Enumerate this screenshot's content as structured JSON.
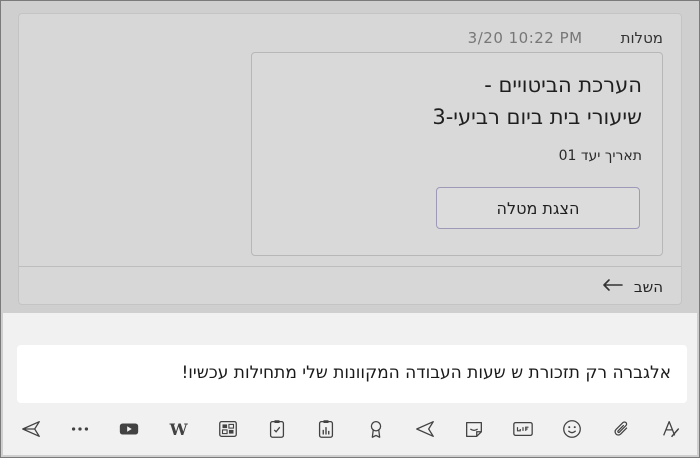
{
  "message": {
    "sender": "מטלות",
    "timestamp": "3/20 10:22 PM",
    "assignment": {
      "title_line1": "הערכת הביטויים -",
      "title_line2": "שיעורי בית ביום רביעי-3",
      "due": "תאריך יעד 01",
      "view_button": "הצגת מטלה"
    },
    "reply_label": "השב"
  },
  "compose": {
    "text": "אלגברה רק תזכורת ש שעות העבודה המקוונות שלי מתחילות עכשיו!"
  },
  "toolbar": {
    "icons": [
      "format-icon",
      "attach-icon",
      "emoji-icon",
      "gif-icon",
      "sticker-icon",
      "stream-icon",
      "praise-icon",
      "poll-icon",
      "approvals-icon",
      "forms-icon",
      "wikipedia-icon",
      "youtube-icon",
      "more-icon",
      "send-icon"
    ],
    "wikipedia_glyph": "W"
  },
  "colors": {
    "overlay": "#cfcfcf",
    "card": "#d7d7d7",
    "compose_bg": "#f1f1f1",
    "button_border": "#9d9ab8"
  }
}
